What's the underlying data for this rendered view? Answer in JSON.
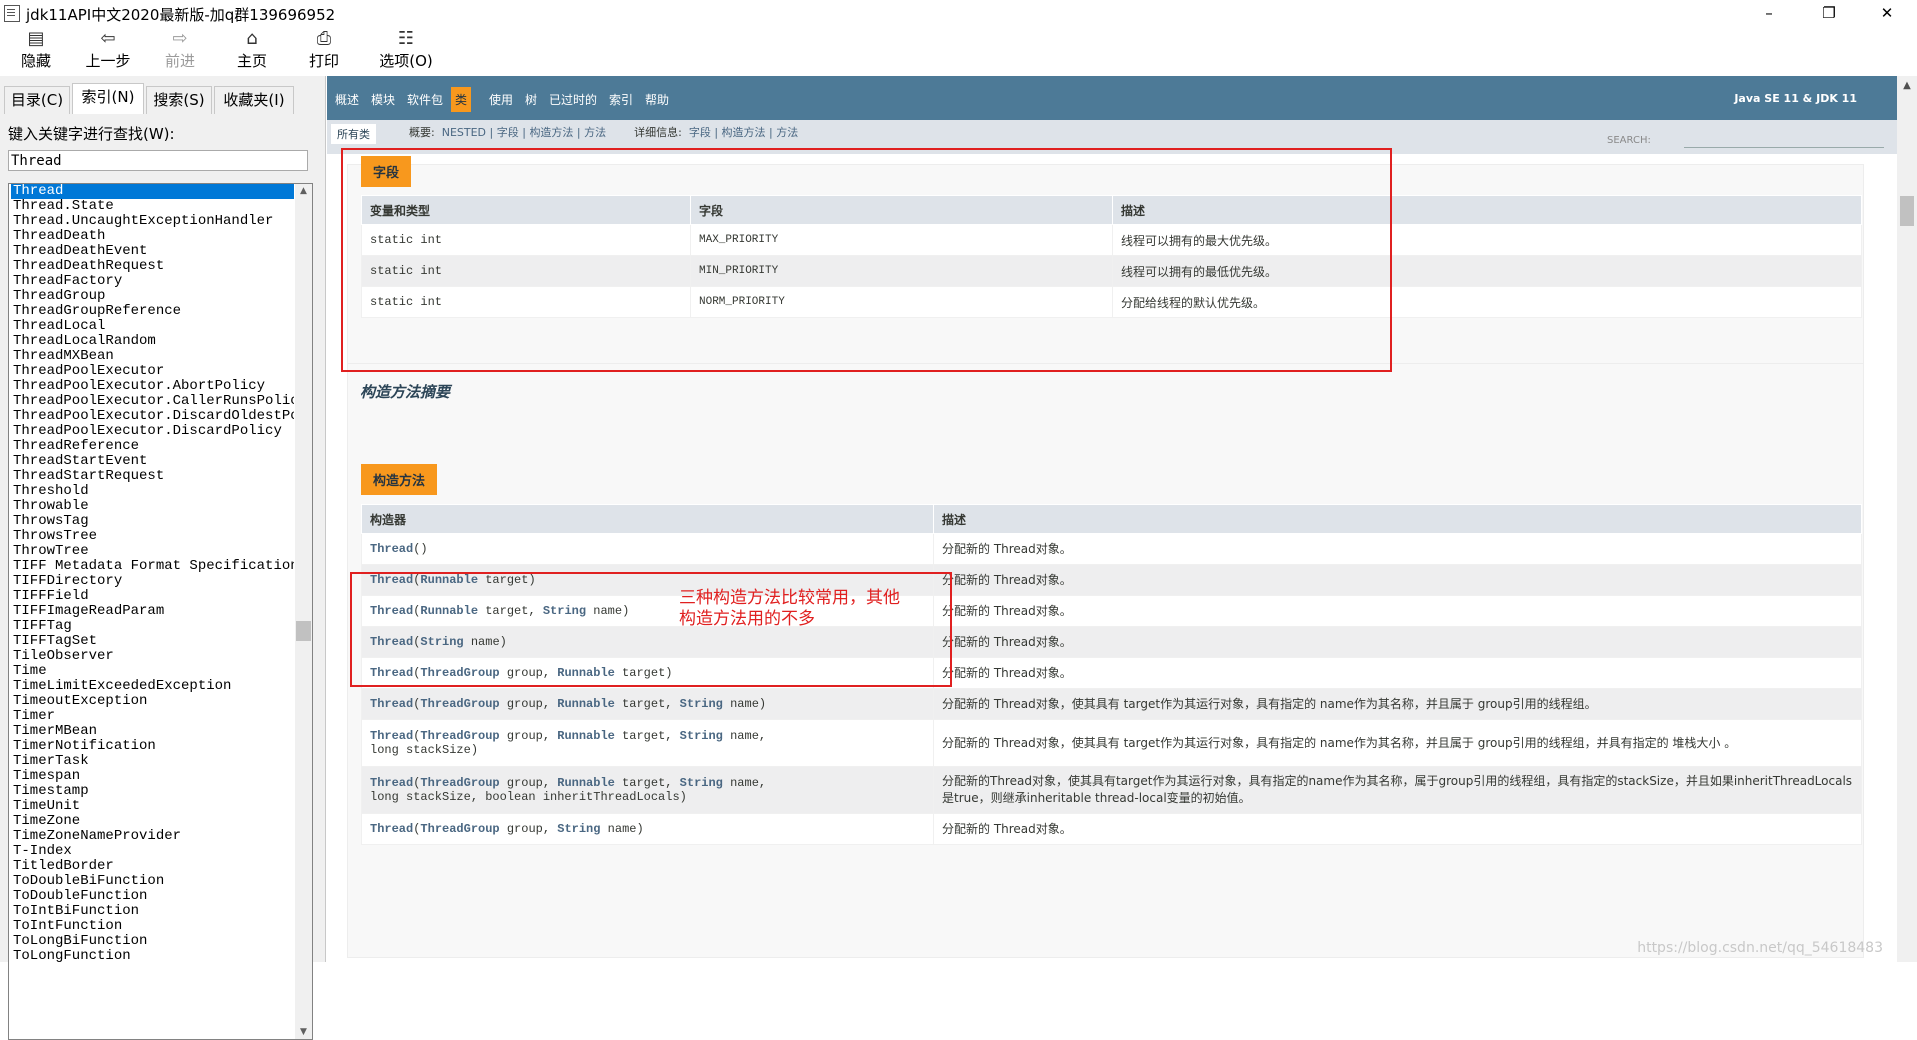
{
  "window": {
    "title": "jdk11API中文2020最新版-加q群139696952",
    "minimize": "–",
    "maximize": "❐",
    "close": "✕"
  },
  "toolbar": {
    "hide": "隐藏",
    "back": "上一步",
    "forward": "前进",
    "home": "主页",
    "print": "打印",
    "options": "选项(O)"
  },
  "left_tabs": {
    "contents": "目录(C)",
    "index": "索引(N)",
    "search": "搜索(S)",
    "favorites": "收藏夹(I)"
  },
  "keyword": {
    "label": "键入关键字进行查找(W):",
    "value": "Thread"
  },
  "index_items": [
    "Thread",
    "Thread.State",
    "Thread.UncaughtExceptionHandler",
    "ThreadDeath",
    "ThreadDeathEvent",
    "ThreadDeathRequest",
    "ThreadFactory",
    "ThreadGroup",
    "ThreadGroupReference",
    "ThreadLocal",
    "ThreadLocalRandom",
    "ThreadMXBean",
    "ThreadPoolExecutor",
    "ThreadPoolExecutor.AbortPolicy",
    "ThreadPoolExecutor.CallerRunsPolicy",
    "ThreadPoolExecutor.DiscardOldestPolicy",
    "ThreadPoolExecutor.DiscardPolicy",
    "ThreadReference",
    "ThreadStartEvent",
    "ThreadStartRequest",
    "Threshold",
    "Throwable",
    "ThrowsTag",
    "ThrowsTree",
    "ThrowTree",
    "TIFF Metadata Format Specification",
    "TIFFDirectory",
    "TIFFField",
    "TIFFImageReadParam",
    "TIFFTag",
    "TIFFTagSet",
    "TileObserver",
    "Time",
    "TimeLimitExceededException",
    "TimeoutException",
    "Timer",
    "TimerMBean",
    "TimerNotification",
    "TimerTask",
    "Timespan",
    "Timestamp",
    "TimeUnit",
    "TimeZone",
    "TimeZoneNameProvider",
    "T-Index",
    "TitledBorder",
    "ToDoubleBiFunction",
    "ToDoubleFunction",
    "ToIntBiFunction",
    "ToIntFunction",
    "ToLongBiFunction",
    "ToLongFunction"
  ],
  "nav": {
    "items": [
      "概述",
      "模块",
      "软件包",
      "类",
      "使用",
      "树",
      "已过时的",
      "索引",
      "帮助"
    ],
    "active": "类",
    "right": "Java SE 11 & JDK 11"
  },
  "subnav": {
    "all_classes": "所有类",
    "summary_label": "概要:",
    "summary_links": [
      "NESTED",
      "字段",
      "构造方法",
      "方法"
    ],
    "detail_label": "详细信息:",
    "detail_links": [
      "字段",
      "构造方法",
      "方法"
    ],
    "search_label": "SEARCH:"
  },
  "fields": {
    "caption": "字段",
    "headers": [
      "变量和类型",
      "字段",
      "描述"
    ],
    "rows": [
      {
        "type": "static int",
        "name": "MAX_PRIORITY",
        "desc": "线程可以拥有的最大优先级。"
      },
      {
        "type": "static int",
        "name": "MIN_PRIORITY",
        "desc": "线程可以拥有的最低优先级。"
      },
      {
        "type": "static int",
        "name": "NORM_PRIORITY",
        "desc": "分配给线程的默认优先级。"
      }
    ]
  },
  "constructors": {
    "section_title": "构造方法摘要",
    "caption": "构造方法",
    "headers": [
      "构造器",
      "描述"
    ],
    "rows": [
      {
        "line1": [
          [
            "lnk",
            "Thread"
          ],
          [
            "t",
            "()"
          ]
        ],
        "line2": [],
        "desc": "分配新的 Thread对象。"
      },
      {
        "line1": [
          [
            "lnk",
            "Thread"
          ],
          [
            "t",
            "("
          ],
          [
            "lnk",
            "Runnable"
          ],
          [
            "t",
            " target)"
          ]
        ],
        "line2": [],
        "desc": "分配新的 Thread对象。"
      },
      {
        "line1": [
          [
            "lnk",
            "Thread"
          ],
          [
            "t",
            "("
          ],
          [
            "lnk",
            "Runnable"
          ],
          [
            "t",
            " target, "
          ],
          [
            "lnk",
            "String"
          ],
          [
            "t",
            " name)"
          ]
        ],
        "line2": [],
        "desc": "分配新的 Thread对象。"
      },
      {
        "line1": [
          [
            "lnk",
            "Thread"
          ],
          [
            "t",
            "("
          ],
          [
            "lnk",
            "String"
          ],
          [
            "t",
            " name)"
          ]
        ],
        "line2": [],
        "desc": "分配新的 Thread对象。"
      },
      {
        "line1": [
          [
            "lnk",
            "Thread"
          ],
          [
            "t",
            "("
          ],
          [
            "lnk",
            "ThreadGroup"
          ],
          [
            "t",
            " group, "
          ],
          [
            "lnk",
            "Runnable"
          ],
          [
            "t",
            " target)"
          ]
        ],
        "line2": [],
        "desc": "分配新的 Thread对象。"
      },
      {
        "line1": [
          [
            "lnk",
            "Thread"
          ],
          [
            "t",
            "("
          ],
          [
            "lnk",
            "ThreadGroup"
          ],
          [
            "t",
            " group, "
          ],
          [
            "lnk",
            "Runnable"
          ],
          [
            "t",
            " target, "
          ],
          [
            "lnk",
            "String"
          ],
          [
            "t",
            " name)"
          ]
        ],
        "line2": [],
        "desc": "分配新的 Thread对象，使其具有 target作为其运行对象，具有指定的 name作为其名称，并且属于 group引用的线程组。"
      },
      {
        "line1": [
          [
            "lnk",
            "Thread"
          ],
          [
            "t",
            "("
          ],
          [
            "lnk",
            "ThreadGroup"
          ],
          [
            "t",
            " group, "
          ],
          [
            "lnk",
            "Runnable"
          ],
          [
            "t",
            " target, "
          ],
          [
            "lnk",
            "String"
          ],
          [
            "t",
            " name,"
          ]
        ],
        "line2": [
          [
            "t",
            "long stackSize)"
          ]
        ],
        "desc": "分配新的 Thread对象，使其具有 target作为其运行对象，具有指定的 name作为其名称，并且属于 group引用的线程组，并具有指定的 堆栈大小 。"
      },
      {
        "line1": [
          [
            "lnk",
            "Thread"
          ],
          [
            "t",
            "("
          ],
          [
            "lnk",
            "ThreadGroup"
          ],
          [
            "t",
            " group, "
          ],
          [
            "lnk",
            "Runnable"
          ],
          [
            "t",
            " target, "
          ],
          [
            "lnk",
            "String"
          ],
          [
            "t",
            " name,"
          ]
        ],
        "line2": [
          [
            "t",
            "long stackSize, boolean inheritThreadLocals)"
          ]
        ],
        "desc": "分配新的Thread对象，使其具有target作为其运行对象，具有指定的name作为其名称，属于group引用的线程组，具有指定的stackSize，并且如果inheritThreadLocals是true，则继承inheritable thread-local变量的初始值。"
      },
      {
        "line1": [
          [
            "lnk",
            "Thread"
          ],
          [
            "t",
            "("
          ],
          [
            "lnk",
            "ThreadGroup"
          ],
          [
            "t",
            " group, "
          ],
          [
            "lnk",
            "String"
          ],
          [
            "t",
            " name)"
          ]
        ],
        "line2": [],
        "desc": "分配新的 Thread对象。"
      }
    ]
  },
  "annotation": {
    "line1": "三种构造方法比较常用，其他",
    "line2": "构造方法用的不多"
  },
  "watermark": "https://blog.csdn.net/qq_54618483",
  "colors": {
    "navbar": "#4d7a97",
    "accent": "#f8981d",
    "annotation": "#e02020",
    "selection": "#0078d7"
  }
}
